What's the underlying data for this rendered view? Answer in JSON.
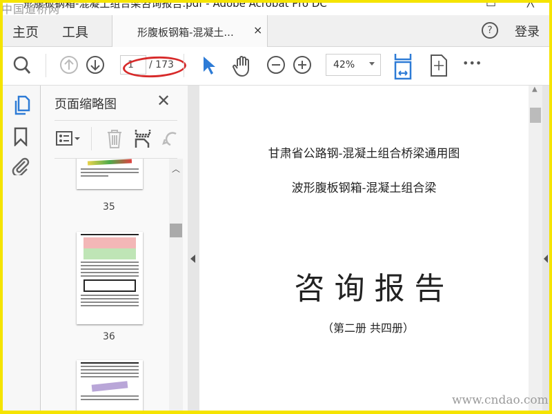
{
  "window": {
    "title": "形腹板钢箱-混凝土组合梁咨询报告.pdf - Adobe Acrobat Pro DC",
    "maximize": "□",
    "close": "╳"
  },
  "watermarks": {
    "top_left": "中国道桥网",
    "bottom_right": "www.cndao.com"
  },
  "nav": {
    "home": "主页",
    "tools": "工具",
    "tab_title": "形腹板钢箱-混凝土...",
    "tab_close": "×",
    "help": "?",
    "login": "登录"
  },
  "toolbar": {
    "current_page": "1",
    "total_pages": "/ 173",
    "zoom": "42%",
    "more": "•••"
  },
  "panel": {
    "title": "页面缩略图",
    "close": "✕",
    "thumbnails": [
      {
        "page": "35"
      },
      {
        "page": "36"
      }
    ]
  },
  "document": {
    "line1": "甘肃省公路钢-混凝土组合桥梁通用图",
    "line2": "波形腹板钢箱-混凝土组合梁",
    "heading": "咨 询 报 告",
    "sub": "（第二册  共四册）"
  },
  "colors": {
    "accent": "#2d7bd6",
    "annotation": "#d72a2a",
    "border": "#f5e400"
  }
}
